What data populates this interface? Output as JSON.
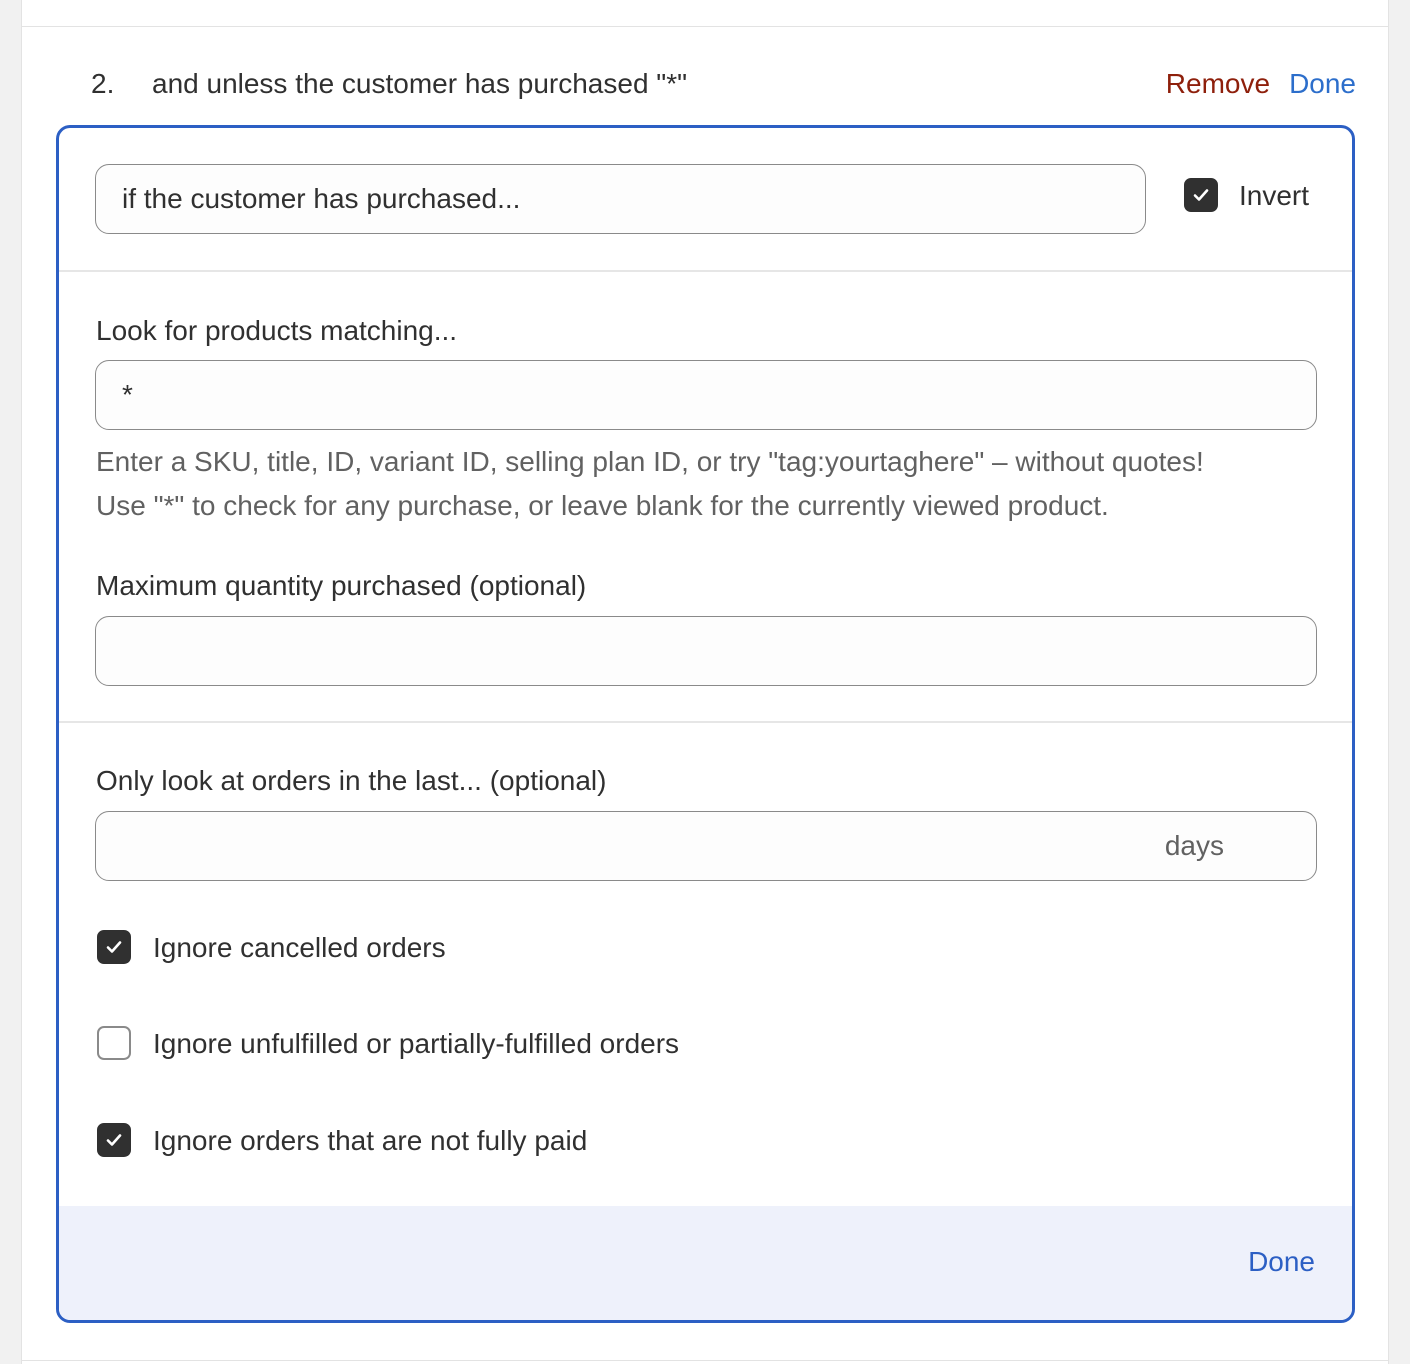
{
  "rule": {
    "number": "2.",
    "title": "and unless the customer has purchased \"*\"",
    "remove_label": "Remove",
    "done_label": "Done"
  },
  "condition": {
    "type_value": "if the customer has purchased...",
    "invert_label": "Invert",
    "invert_checked": true
  },
  "products": {
    "label": "Look for products matching...",
    "value": "*",
    "help_line1": "Enter a SKU, title, ID, variant ID, selling plan ID, or try \"tag:yourtaghere\" – without quotes!",
    "help_line2": "Use \"*\" to check for any purchase, or leave blank for the currently viewed product."
  },
  "max_quantity": {
    "label": "Maximum quantity purchased (optional)",
    "value": ""
  },
  "lookback": {
    "label": "Only look at orders in the last... (optional)",
    "value": "",
    "suffix": "days"
  },
  "options": [
    {
      "label": "Ignore cancelled orders",
      "checked": true
    },
    {
      "label": "Ignore unfulfilled or partially-fulfilled orders",
      "checked": false
    },
    {
      "label": "Ignore orders that are not fully paid",
      "checked": true
    }
  ],
  "footer": {
    "done_label": "Done"
  },
  "colors": {
    "accent": "#2c5fc4",
    "remove": "#8e1f0b",
    "footer_bg": "#eef1fb"
  }
}
